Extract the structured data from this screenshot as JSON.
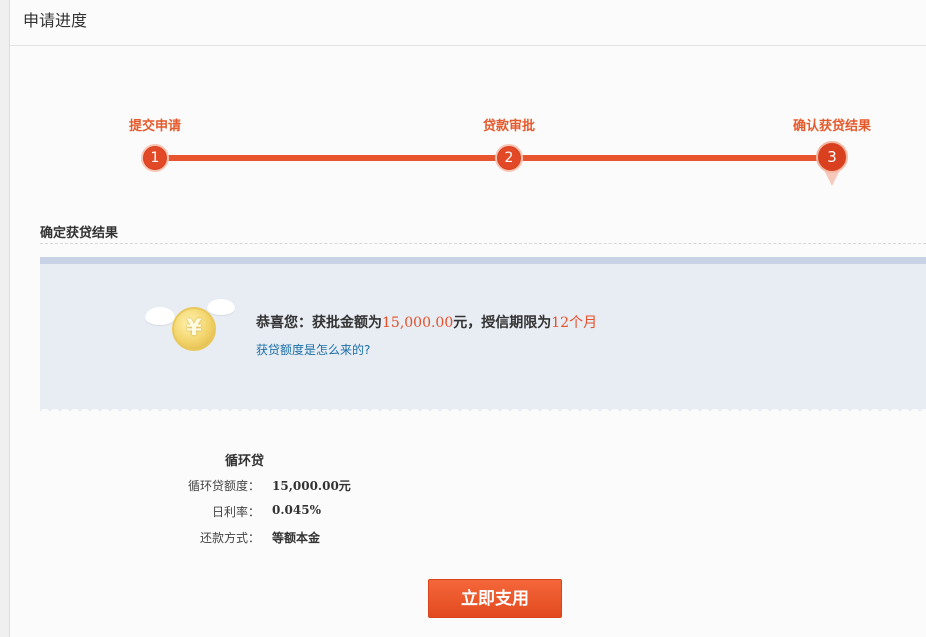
{
  "page": {
    "title": "申请进度"
  },
  "steps": [
    {
      "number": "1",
      "label": "提交申请"
    },
    {
      "number": "2",
      "label": "贷款审批"
    },
    {
      "number": "3",
      "label": "确认获贷结果"
    }
  ],
  "result": {
    "section_title": "确定获贷结果",
    "coin_icon": "yuan-coin-icon",
    "coin_glyph": "¥",
    "congrats_prefix": "恭喜您：获批金额为",
    "amount": "15,000.00",
    "amount_unit": "元，授信期限为",
    "term": "12个月",
    "help_link": "获贷额度是怎么来的?"
  },
  "loan": {
    "type": "循环贷",
    "rows": [
      {
        "label": "循环贷额度：",
        "value": "15,000.00元"
      },
      {
        "label": "日利率：",
        "value": "0.045%"
      },
      {
        "label": "还款方式：",
        "value": "等额本金"
      }
    ]
  },
  "actions": {
    "use_now": "立即支用"
  },
  "colors": {
    "accent": "#e8542d",
    "link": "#1a6fa8",
    "result_bg": "#e8ecf3"
  }
}
